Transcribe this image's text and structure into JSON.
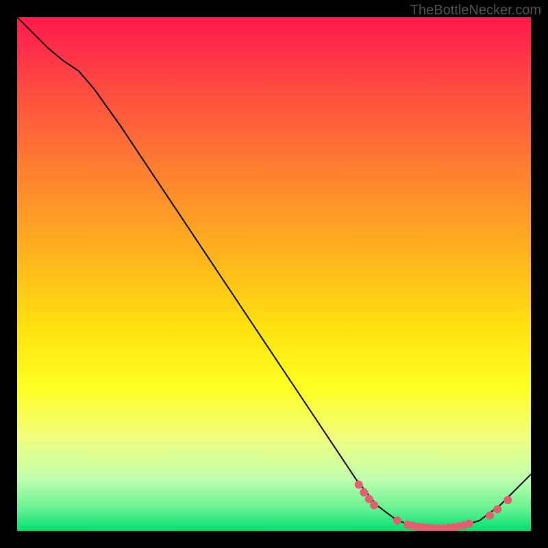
{
  "watermark": "TheBottleNecker.com",
  "chart_data": {
    "type": "line",
    "title": "",
    "xlabel": "",
    "ylabel": "",
    "xlim": [
      0,
      100
    ],
    "ylim": [
      0,
      100
    ],
    "background": {
      "type": "vertical-gradient",
      "stops": [
        {
          "offset": 0.0,
          "color": "#ff1a4d"
        },
        {
          "offset": 0.05,
          "color": "#ff2a4a"
        },
        {
          "offset": 0.15,
          "color": "#ff5040"
        },
        {
          "offset": 0.3,
          "color": "#ff8030"
        },
        {
          "offset": 0.45,
          "color": "#ffb020"
        },
        {
          "offset": 0.6,
          "color": "#ffe010"
        },
        {
          "offset": 0.72,
          "color": "#ffff20"
        },
        {
          "offset": 0.82,
          "color": "#f0ff80"
        },
        {
          "offset": 0.9,
          "color": "#c0ffb0"
        },
        {
          "offset": 0.96,
          "color": "#60f090"
        },
        {
          "offset": 1.0,
          "color": "#00e070"
        }
      ]
    },
    "series": [
      {
        "name": "bottleneck-curve",
        "color": "#000000",
        "width": 2,
        "data": [
          {
            "x": 0.0,
            "y": 100.0
          },
          {
            "x": 3.0,
            "y": 97.0
          },
          {
            "x": 6.0,
            "y": 94.0
          },
          {
            "x": 9.0,
            "y": 91.5
          },
          {
            "x": 12.0,
            "y": 89.5
          },
          {
            "x": 15.0,
            "y": 86.0
          },
          {
            "x": 20.0,
            "y": 79.0
          },
          {
            "x": 30.0,
            "y": 64.0
          },
          {
            "x": 40.0,
            "y": 49.0
          },
          {
            "x": 50.0,
            "y": 34.0
          },
          {
            "x": 60.0,
            "y": 19.0
          },
          {
            "x": 66.0,
            "y": 10.0
          },
          {
            "x": 70.0,
            "y": 5.0
          },
          {
            "x": 74.0,
            "y": 2.0
          },
          {
            "x": 78.0,
            "y": 0.8
          },
          {
            "x": 82.0,
            "y": 0.5
          },
          {
            "x": 86.0,
            "y": 0.8
          },
          {
            "x": 90.0,
            "y": 2.0
          },
          {
            "x": 94.0,
            "y": 5.0
          },
          {
            "x": 98.0,
            "y": 9.0
          },
          {
            "x": 100.0,
            "y": 11.0
          }
        ]
      }
    ],
    "markers": {
      "name": "highlight-dots",
      "color": "#e06070",
      "radius": 6,
      "data": [
        {
          "x": 66.5,
          "y": 9.0
        },
        {
          "x": 67.5,
          "y": 7.5
        },
        {
          "x": 68.5,
          "y": 6.2
        },
        {
          "x": 69.5,
          "y": 5.0
        },
        {
          "x": 74.0,
          "y": 2.0
        },
        {
          "x": 76.0,
          "y": 1.2
        },
        {
          "x": 77.0,
          "y": 1.0
        },
        {
          "x": 78.0,
          "y": 0.8
        },
        {
          "x": 79.0,
          "y": 0.7
        },
        {
          "x": 80.0,
          "y": 0.6
        },
        {
          "x": 81.0,
          "y": 0.5
        },
        {
          "x": 82.0,
          "y": 0.5
        },
        {
          "x": 83.0,
          "y": 0.5
        },
        {
          "x": 84.0,
          "y": 0.6
        },
        {
          "x": 85.0,
          "y": 0.7
        },
        {
          "x": 86.0,
          "y": 0.9
        },
        {
          "x": 87.0,
          "y": 1.1
        },
        {
          "x": 88.0,
          "y": 1.4
        },
        {
          "x": 92.0,
          "y": 3.0
        },
        {
          "x": 93.5,
          "y": 4.2
        },
        {
          "x": 95.5,
          "y": 6.0
        }
      ]
    }
  }
}
